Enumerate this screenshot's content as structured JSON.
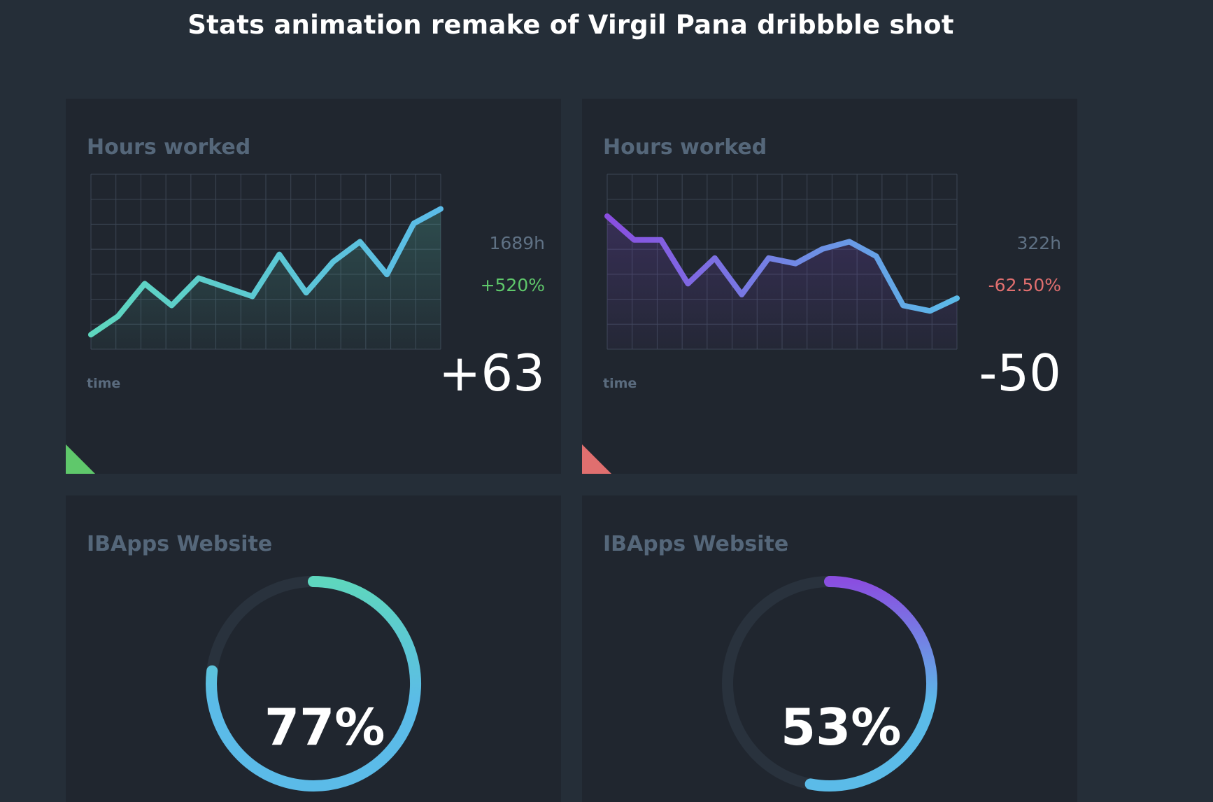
{
  "page_title": "Stats animation remake of Virgil Pana dribbble shot",
  "colors": {
    "background": "#252e38",
    "card": "#20262f",
    "grid": "#3c4654",
    "positive": "#5fc86b",
    "negative": "#e06f6f",
    "teal": "#5ed6be",
    "blue": "#5bbbe8",
    "purple": "#8a4ee0"
  },
  "cards": [
    {
      "title": "Hours worked",
      "total": "1689h",
      "change": "+520%",
      "change_status": "positive",
      "big_value": "+63",
      "axis_label": "time"
    },
    {
      "title": "Hours worked",
      "total": "322h",
      "change": "-62.50%",
      "change_status": "negative",
      "big_value": "-50",
      "axis_label": "time"
    },
    {
      "title": "IBApps Website",
      "percent_label": "77%"
    },
    {
      "title": "IBApps Website",
      "percent_label": "53%"
    }
  ],
  "chart_data": [
    {
      "type": "area",
      "title": "Hours worked",
      "xlabel": "time",
      "ylabel": "",
      "x": [
        0,
        1,
        2,
        3,
        4,
        5,
        6,
        7,
        8,
        9,
        10,
        11,
        12,
        13
      ],
      "values": [
        0.8,
        1.8,
        3.6,
        2.4,
        3.9,
        3.4,
        2.9,
        5.2,
        3.1,
        4.8,
        5.9,
        4.1,
        6.9,
        7.7
      ],
      "ylim": [
        0,
        9.6
      ],
      "grid": true,
      "gradient": [
        "#5ed6be",
        "#5bbbe8"
      ]
    },
    {
      "type": "area",
      "title": "Hours worked",
      "xlabel": "time",
      "ylabel": "",
      "x": [
        0,
        1,
        2,
        3,
        4,
        5,
        6,
        7,
        8,
        9,
        10,
        11,
        12,
        13
      ],
      "values": [
        7.3,
        6.0,
        6.0,
        3.6,
        5.0,
        3.0,
        5.0,
        4.7,
        5.5,
        5.9,
        5.1,
        2.4,
        2.1,
        2.8
      ],
      "ylim": [
        0,
        9.6
      ],
      "grid": true,
      "gradient": [
        "#8a4ee0",
        "#5bbbe8"
      ]
    },
    {
      "type": "pie",
      "title": "IBApps Website",
      "values": [
        77,
        23
      ],
      "categories": [
        "complete",
        "remaining"
      ],
      "gradient": [
        "#5ed6be",
        "#5bbbe8"
      ]
    },
    {
      "type": "pie",
      "title": "IBApps Website",
      "values": [
        53,
        47
      ],
      "categories": [
        "complete",
        "remaining"
      ],
      "gradient": [
        "#8a4ee0",
        "#5bbbe8"
      ]
    }
  ]
}
